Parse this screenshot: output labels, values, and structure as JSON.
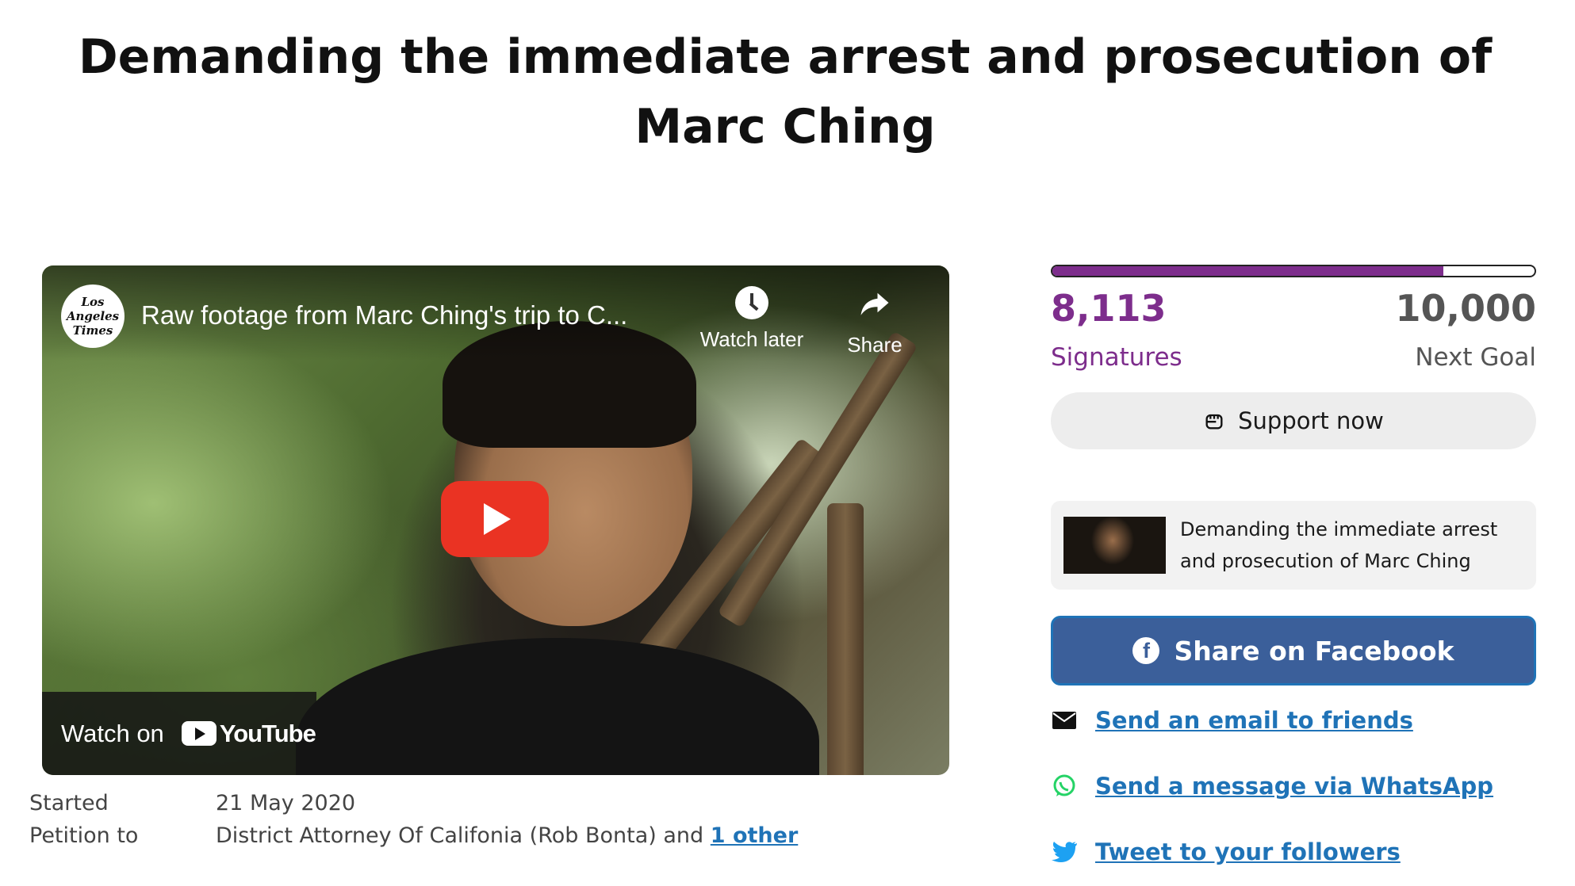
{
  "petition": {
    "title": "Demanding the immediate arrest and prosecution of Marc Ching"
  },
  "video": {
    "channel_logo_text": "Los Angeles Times",
    "title": "Raw footage from Marc Ching's trip to C...",
    "watch_later_label": "Watch later",
    "share_label": "Share",
    "watch_on_label": "Watch on",
    "youtube_label": "YouTube"
  },
  "meta": {
    "started_label": "Started",
    "started_value": "21 May 2020",
    "petition_to_label": "Petition to",
    "petition_to_value": "District Attorney Of Califonia (Rob Bonta) and",
    "petition_to_link": "1 other"
  },
  "stats": {
    "signatures": "8,113",
    "signatures_label": "Signatures",
    "goal": "10,000",
    "goal_label": "Next Goal",
    "progress_fraction": 0.8113
  },
  "support_button_label": "Support now",
  "share_card_text": "Demanding the immediate arrest and prosecution of Marc Ching",
  "share": {
    "facebook_label": "Share on Facebook",
    "email_label": "Send an email to friends",
    "whatsapp_label": "Send a message via WhatsApp",
    "twitter_label": "Tweet to your followers"
  },
  "colors": {
    "accent": "#7d2d8c",
    "link": "#1f73b7",
    "facebook": "#3b5f9a",
    "youtube_red": "#ea3323",
    "whatsapp": "#25d366",
    "twitter": "#1da1f2"
  },
  "icons": [
    "clock-icon",
    "share-arrow-icon",
    "play-icon",
    "youtube-logo-icon",
    "fist-icon",
    "facebook-icon",
    "email-icon",
    "whatsapp-icon",
    "twitter-icon"
  ]
}
